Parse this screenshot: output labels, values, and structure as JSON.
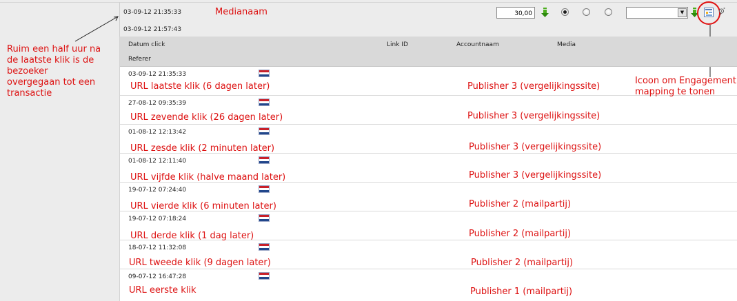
{
  "header": {
    "time_first": "03-09-12 21:35:33",
    "time_second": "03-09-12 21:57:43",
    "medianaam_label": "Medianaam",
    "amount_value": "30,00",
    "select_value": ""
  },
  "columns": {
    "datum_click": "Datum click",
    "link_id": "Link ID",
    "accountnaam": "Accountnaam",
    "media": "Media",
    "referer": "Referer"
  },
  "annotations": {
    "left_note_lines": [
      "Ruim een half uur na",
      "de laatste klik is de",
      "bezoeker",
      "overgegaan tot een",
      "transactie"
    ],
    "icon_note_lines": [
      "Icoon om Engagement",
      "mapping te tonen"
    ]
  },
  "colors": {
    "annotation_red": "#dd1111",
    "header_bg": "#ececec",
    "column_header_bg": "#d9d9d9",
    "download_green": "#4cae1e"
  },
  "rows": [
    {
      "date": "03-09-12 21:35:33",
      "url_note": "URL laatste klik (6 dagen later)",
      "publisher_note": "Publisher 3 (vergelijkingssite)",
      "flag": "netherlands-flag-icon"
    },
    {
      "date": "27-08-12 09:35:39",
      "url_note": "URL zevende klik (26 dagen later)",
      "publisher_note": "Publisher 3 (vergelijkingssite)",
      "flag": "netherlands-flag-icon"
    },
    {
      "date": "01-08-12 12:13:42",
      "url_note": "URL zesde klik (2 minuten later)",
      "publisher_note": "Publisher 3 (vergelijkingssite)",
      "flag": "netherlands-flag-icon"
    },
    {
      "date": "01-08-12 12:11:40",
      "url_note": "URL vijfde klik (halve maand later)",
      "publisher_note": "Publisher 3 (vergelijkingssite)",
      "flag": "netherlands-flag-icon"
    },
    {
      "date": "19-07-12 07:24:40",
      "url_note": "URL vierde klik (6 minuten later)",
      "publisher_note": "Publisher 2 (mailpartij)",
      "flag": "netherlands-flag-icon"
    },
    {
      "date": "19-07-12 07:18:24",
      "url_note": "URL derde klik (1 dag later)",
      "publisher_note": "Publisher 2 (mailpartij)",
      "flag": "netherlands-flag-icon"
    },
    {
      "date": "18-07-12 11:32:08",
      "url_note": "URL tweede klik (9 dagen later)",
      "publisher_note": "Publisher 2 (mailpartij)",
      "flag": "netherlands-flag-icon"
    },
    {
      "date": "09-07-12 16:47:28",
      "url_note": "URL eerste klik",
      "publisher_note": "Publisher 1 (mailpartij)",
      "flag": "netherlands-flag-icon"
    }
  ]
}
